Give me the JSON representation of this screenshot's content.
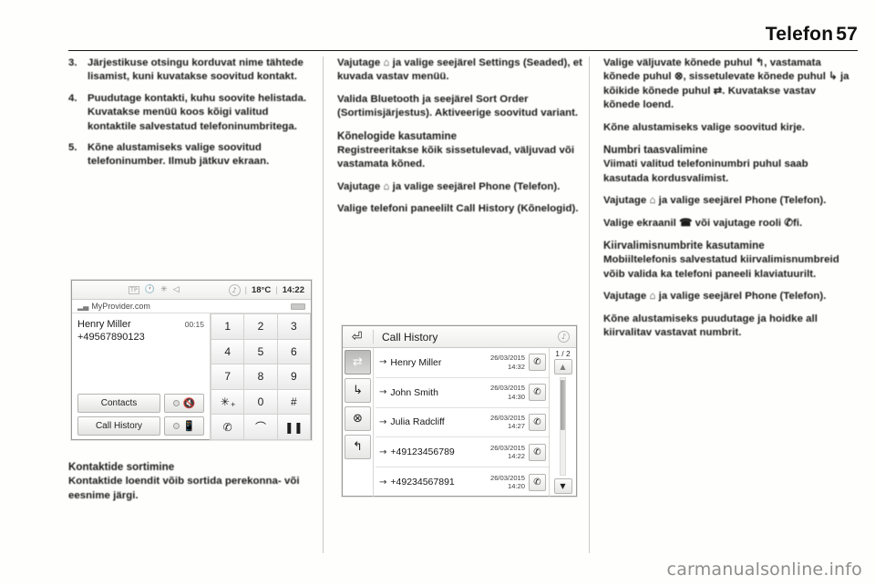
{
  "header": {
    "title": "Telefon",
    "page_number": "57"
  },
  "columns": {
    "left": {
      "steps": [
        {
          "num": "3.",
          "text": "Järjestikuse otsingu korduvat nime tähtede lisamist, kuni kuvatakse soovitud kontakt."
        },
        {
          "num": "4.",
          "text": "Puudutage kontakti, kuhu soovite helistada. Kuvatakse menüü koos kõigi valitud kontaktile salvestatud telefoninumbritega."
        },
        {
          "num": "5.",
          "text": "Kõne alustamiseks valige soovitud telefoninumber. Ilmub jätkuv ekraan."
        }
      ],
      "caption_heading": "Kontaktide sortimine",
      "caption_text": "Kontaktide loendit võib sortida perekonna- või eesnime järgi."
    },
    "middle": {
      "para1": "Vajutage ⌂ ja valige seejärel Settings (Seaded), et kuvada vastav menüü.",
      "para2": "Valida Bluetooth ja seejärel Sort Order (Sortimisjärjestus). Aktiveerige soovitud variant.",
      "heading1": "Kõnelogide kasutamine",
      "para3": "Registreeritakse kõik sissetulevad, väljuvad või vastamata kõned.",
      "para4": "Vajutage ⌂ ja valige seejärel Phone (Telefon).",
      "para5": "Valige telefoni paneelilt Call History (Kõnelogid)."
    },
    "right": {
      "para1": "Valige väljuvate kõnede puhul ↰, vastamata kõnede puhul ⊗, sissetulevate kõnede puhul ↳ ja kõikide kõnede puhul ⇄. Kuvatakse vastav kõnede loend.",
      "para2": "Kõne alustamiseks valige soovitud kirje.",
      "heading1": "Numbri taasvalimine",
      "para3": "Viimati valitud telefoninumbri puhul saab kasutada kordusvalimist.",
      "para4": "Vajutage ⌂ ja valige seejärel Phone (Telefon).",
      "para5": "Valige ekraanil ☎ või vajutage rooli ✆ﬁ.",
      "heading2": "Kiirvalimisnumbrite kasutamine",
      "para6": "Mobiiltelefonis salvestatud kiirvalimisnumbreid võib valida ka telefoni paneeli klaviatuurilt.",
      "para7": "Vajutage ⌂ ja valige seejärel Phone (Telefon).",
      "para8": "Kõne alustamiseks puudutage ja hoidke all kiirvalitav vastavat numbrit."
    }
  },
  "screenshot_phone": {
    "status_bar": {
      "tp_label": "TP",
      "clock_icon": "🕐",
      "bluetooth_icon": "✳",
      "speaker_icon": "◁",
      "music_icon": "♪",
      "temperature": "18°C",
      "time": "14:22",
      "separator": "|"
    },
    "provider": "MyProvider.com",
    "caller_name": "Henry Miller",
    "call_duration": "00:15",
    "caller_number": "+49567890123",
    "buttons": {
      "contacts": "Contacts",
      "call_history": "Call History",
      "mute_icon": "🔇",
      "handset_icon": "▯",
      "mute_arrow": "↗"
    },
    "keypad": [
      {
        "main": "1",
        "sub": ""
      },
      {
        "main": "2",
        "sub": ""
      },
      {
        "main": "3",
        "sub": ""
      },
      {
        "main": "4",
        "sub": ""
      },
      {
        "main": "5",
        "sub": ""
      },
      {
        "main": "6",
        "sub": ""
      },
      {
        "main": "7",
        "sub": ""
      },
      {
        "main": "8",
        "sub": ""
      },
      {
        "main": "9",
        "sub": ""
      },
      {
        "main": "✳",
        "sub": "+"
      },
      {
        "main": "0",
        "sub": ""
      },
      {
        "main": "#",
        "sub": ""
      },
      {
        "main": "✆",
        "sub": ""
      },
      {
        "main": "⌒",
        "sub": ""
      },
      {
        "main": "❚❚",
        "sub": ""
      }
    ]
  },
  "screenshot_call_history": {
    "back_icon": "⏎",
    "title": "Call History",
    "music_icon": "♪",
    "page_indicator": "1 / 2",
    "scroll_up_icon": "▲",
    "scroll_down_icon": "▼",
    "filter_tabs": [
      {
        "icon": "⇄",
        "name": "all-calls",
        "active": true
      },
      {
        "icon": "↳",
        "name": "incoming-calls",
        "active": false
      },
      {
        "icon": "⊗",
        "name": "missed-calls",
        "active": false
      },
      {
        "icon": "↰",
        "name": "outgoing-calls",
        "active": false
      }
    ],
    "columns": [
      "name",
      "date",
      "time"
    ],
    "rows": [
      {
        "arrow": "→",
        "name": "Henry Miller",
        "date": "26/03/2015",
        "time": "14:32",
        "call_icon": "✆"
      },
      {
        "arrow": "→",
        "name": "John Smith",
        "date": "26/03/2015",
        "time": "14:30",
        "call_icon": "✆"
      },
      {
        "arrow": "→",
        "name": "Julia Radcliff",
        "date": "26/03/2015",
        "time": "14:27",
        "call_icon": "✆"
      },
      {
        "arrow": "→",
        "name": "+49123456789",
        "date": "26/03/2015",
        "time": "14:22",
        "call_icon": "✆"
      },
      {
        "arrow": "→",
        "name": "+49234567891",
        "date": "26/03/2015",
        "time": "14:20",
        "call_icon": "✆"
      }
    ]
  },
  "watermark": "carmanualsonline.info"
}
